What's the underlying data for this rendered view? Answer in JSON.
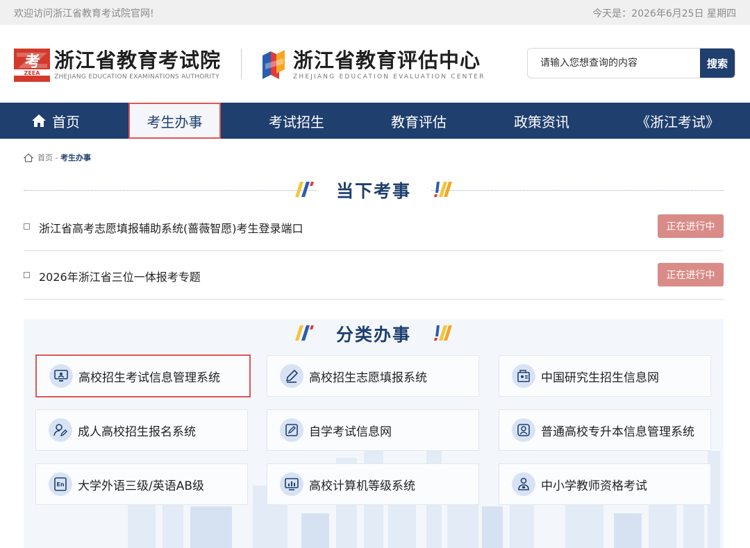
{
  "topbar": {
    "welcome": "欢迎访问浙江省教育考试院官网!",
    "date": "今天是：2026年6月25日 星期四"
  },
  "header": {
    "org1_title": "浙江省教育考试院",
    "org1_sub": "ZHEJIANG EDUCATION EXAMINATIONS AUTHORITY",
    "org1_logo_text": "ZEEA",
    "org2_title": "浙江省教育评估中心",
    "org2_sub": "ZHEJIANG EDUCATION EVALUATION CENTER",
    "search_placeholder": "请输入您想查询的内容",
    "search_button": "搜索"
  },
  "nav": {
    "items": [
      {
        "label": "首页",
        "icon": "home-icon"
      },
      {
        "label": "考生办事",
        "active": true
      },
      {
        "label": "考试招生"
      },
      {
        "label": "教育评估"
      },
      {
        "label": "政策资讯"
      },
      {
        "label": "《浙江考试》"
      }
    ]
  },
  "breadcrumb": {
    "home": "首页",
    "sep": " - ",
    "current": "考生办事"
  },
  "current_section": {
    "title": "当下考事",
    "items": [
      {
        "text": "浙江省高考志愿填报辅助系统(蔷薇智愿)考生登录端口",
        "status": "正在进行中"
      },
      {
        "text": "2026年浙江省三位一体报考专题",
        "status": "正在进行中"
      }
    ]
  },
  "category_section": {
    "title": "分类办事",
    "cards": [
      {
        "label": "高校招生考试信息管理系统",
        "icon": "monitor-icon",
        "highlighted": true
      },
      {
        "label": "高校招生志愿填报系统",
        "icon": "pencil-icon"
      },
      {
        "label": "中国研究生招生信息网",
        "icon": "graduate-board-icon"
      },
      {
        "label": "成人高校招生报名系统",
        "icon": "user-edit-icon"
      },
      {
        "label": "自学考试信息网",
        "icon": "edit-doc-icon"
      },
      {
        "label": "普通高校专升本信息管理系统",
        "icon": "user-card-icon"
      },
      {
        "label": "大学外语三级/英语AB级",
        "icon": "english-doc-icon"
      },
      {
        "label": "高校计算机等级系统",
        "icon": "computer-chart-icon"
      },
      {
        "label": "中小学教师资格考试",
        "icon": "teacher-icon"
      }
    ]
  },
  "colors": {
    "primary": "#1f3f6e",
    "highlight_border": "#e05555",
    "badge": "#d98c87",
    "icon_bg": "#d7e3f4",
    "panel_bg": "#f3f7fc"
  }
}
